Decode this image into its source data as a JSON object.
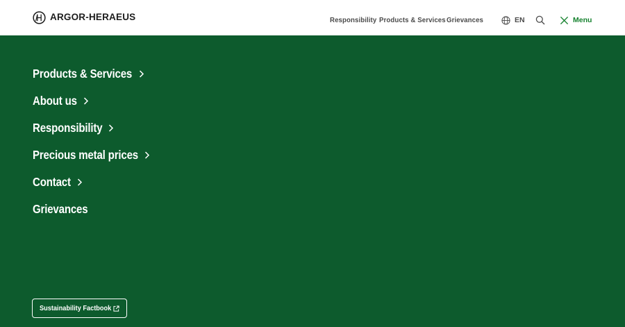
{
  "header": {
    "brand": "ARGOR-HERAEUS",
    "logo_icon": "ah-monogram-icon",
    "nav": [
      {
        "label": "Responsibility"
      },
      {
        "label": "Products & Services"
      },
      {
        "label": "Grievances"
      }
    ],
    "language": {
      "icon": "globe-icon",
      "label": "EN"
    },
    "search_icon": "search-icon",
    "menu": {
      "icon": "close-icon",
      "label": "Menu"
    }
  },
  "menu": {
    "items": [
      {
        "label": "Products & Services",
        "has_submenu": true
      },
      {
        "label": "About us",
        "has_submenu": true
      },
      {
        "label": "Responsibility",
        "has_submenu": true
      },
      {
        "label": "Precious metal prices",
        "has_submenu": true
      },
      {
        "label": "Contact",
        "has_submenu": true
      },
      {
        "label": "Grievances",
        "has_submenu": false
      }
    ]
  },
  "footer_button": {
    "label": "Sustainability Factbook",
    "icon": "external-link-icon"
  },
  "colors": {
    "background": "#0d5b2d",
    "header": "#ffffff",
    "accent": "#16822f",
    "nav_text": "#4b4b4b",
    "menu_text": "#ffffff"
  }
}
